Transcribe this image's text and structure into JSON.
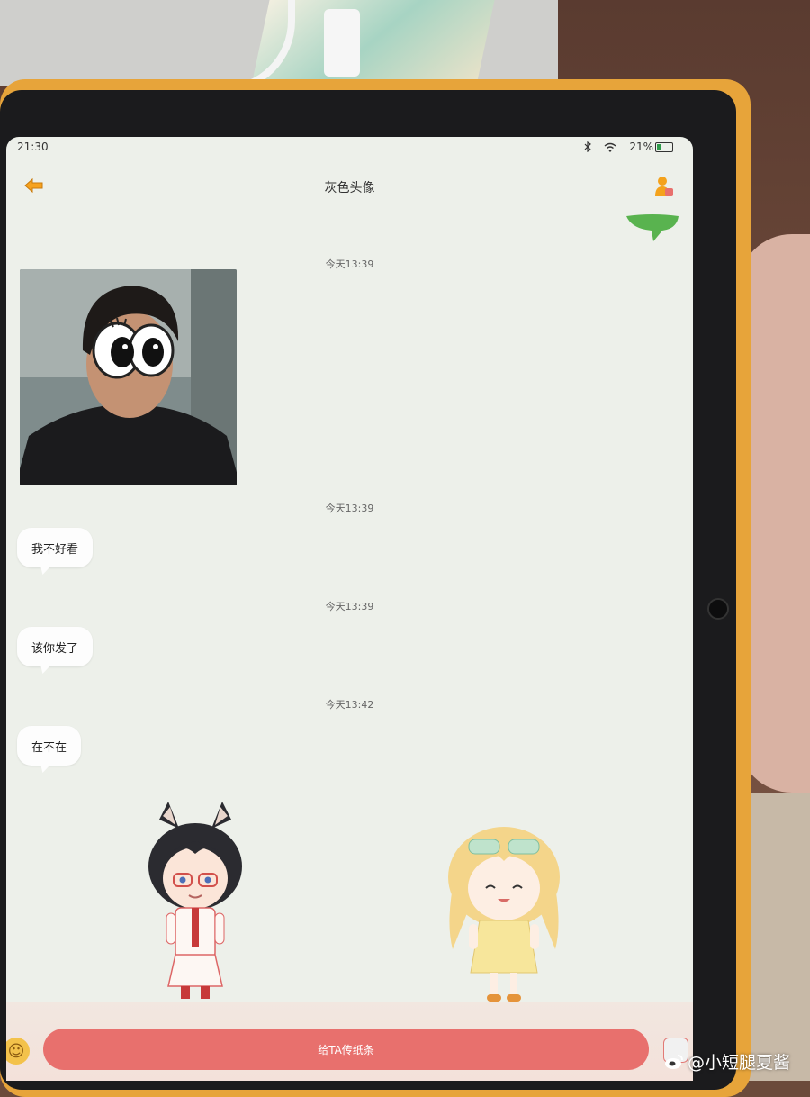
{
  "status_bar": {
    "time": "21:30",
    "battery": "21%"
  },
  "header": {
    "title": "灰色头像"
  },
  "messages": [
    {
      "timestamp": "今天13:39"
    },
    {
      "timestamp": "今天13:39",
      "text": "我不好看"
    },
    {
      "timestamp": "今天13:39",
      "text": "该你发了"
    },
    {
      "timestamp": "今天13:42",
      "text": "在不在"
    }
  ],
  "footer": {
    "send_note_label": "给TA传纸条"
  },
  "icons": {
    "back": "back-arrow-icon",
    "profile": "profile-icon",
    "bluetooth": "bluetooth-icon",
    "wifi": "wifi-icon",
    "battery": "battery-icon",
    "emoji": "emoji-icon",
    "image": "image-icon"
  },
  "colors": {
    "accent": "#e8706d",
    "case": "#e7a43a",
    "bubble_green": "#59b34f"
  },
  "watermark": {
    "text": "@小短腿夏酱"
  }
}
